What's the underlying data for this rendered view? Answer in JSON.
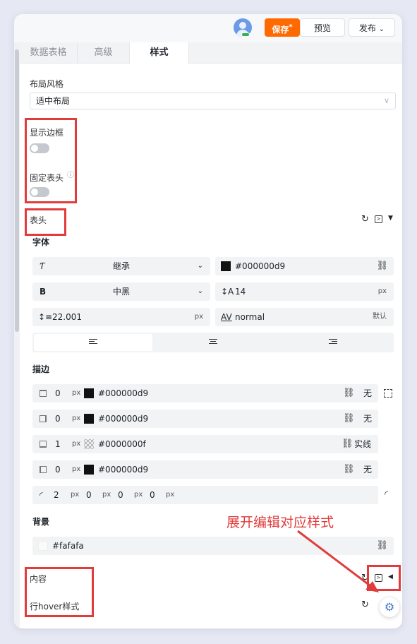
{
  "toolbar": {
    "save_label": "保存",
    "save_mark": "*",
    "preview_label": "预览",
    "publish_label": "发布",
    "publish_caret": "⌄"
  },
  "tabs": [
    {
      "label": "数据表格",
      "active": false
    },
    {
      "label": "高级",
      "active": false
    },
    {
      "label": "样式",
      "active": true
    }
  ],
  "layout": {
    "label": "布局风格",
    "value": "适中布局"
  },
  "toggles": {
    "show_border_label": "显示边框",
    "fixed_header_label": "固定表头",
    "show_border_on": false,
    "fixed_header_on": false
  },
  "header_section": {
    "title": "表头",
    "font_title": "字体",
    "font_family": "继承",
    "font_color": "#000000d9",
    "font_weight_icon": "B",
    "font_weight": "中黑",
    "font_size": "14",
    "font_size_unit": "px",
    "line_height": "22.001",
    "line_height_unit": "px",
    "letter_spacing": "normal",
    "letter_spacing_default": "默认",
    "stroke_title": "描边",
    "strokes": [
      {
        "width": "0",
        "unit": "px",
        "color": "#000000d9",
        "style": "无"
      },
      {
        "width": "0",
        "unit": "px",
        "color": "#000000d9",
        "style": "无"
      },
      {
        "width": "1",
        "unit": "px",
        "color": "#0000000f",
        "style": "实线"
      },
      {
        "width": "0",
        "unit": "px",
        "color": "#000000d9",
        "style": "无"
      }
    ],
    "radius": [
      {
        "value": "2",
        "unit": "px"
      },
      {
        "value": "0",
        "unit": "px"
      },
      {
        "value": "0",
        "unit": "px"
      },
      {
        "value": "0",
        "unit": "px"
      }
    ],
    "background_title": "背景",
    "background_color": "#fafafa"
  },
  "content_section": {
    "title": "内容"
  },
  "row_hover_section": {
    "title": "行hover样式"
  },
  "annotation": "展开编辑对应样式",
  "colors": {
    "accent": "#ff6a00",
    "annotation_red": "#e23b3b",
    "field_bg": "#f2f3f5"
  },
  "icons": {
    "refresh": "refresh-icon",
    "code": "code-icon",
    "collapse": "caret-down-icon",
    "expand": "caret-left-icon",
    "settings": "gear-icon"
  }
}
